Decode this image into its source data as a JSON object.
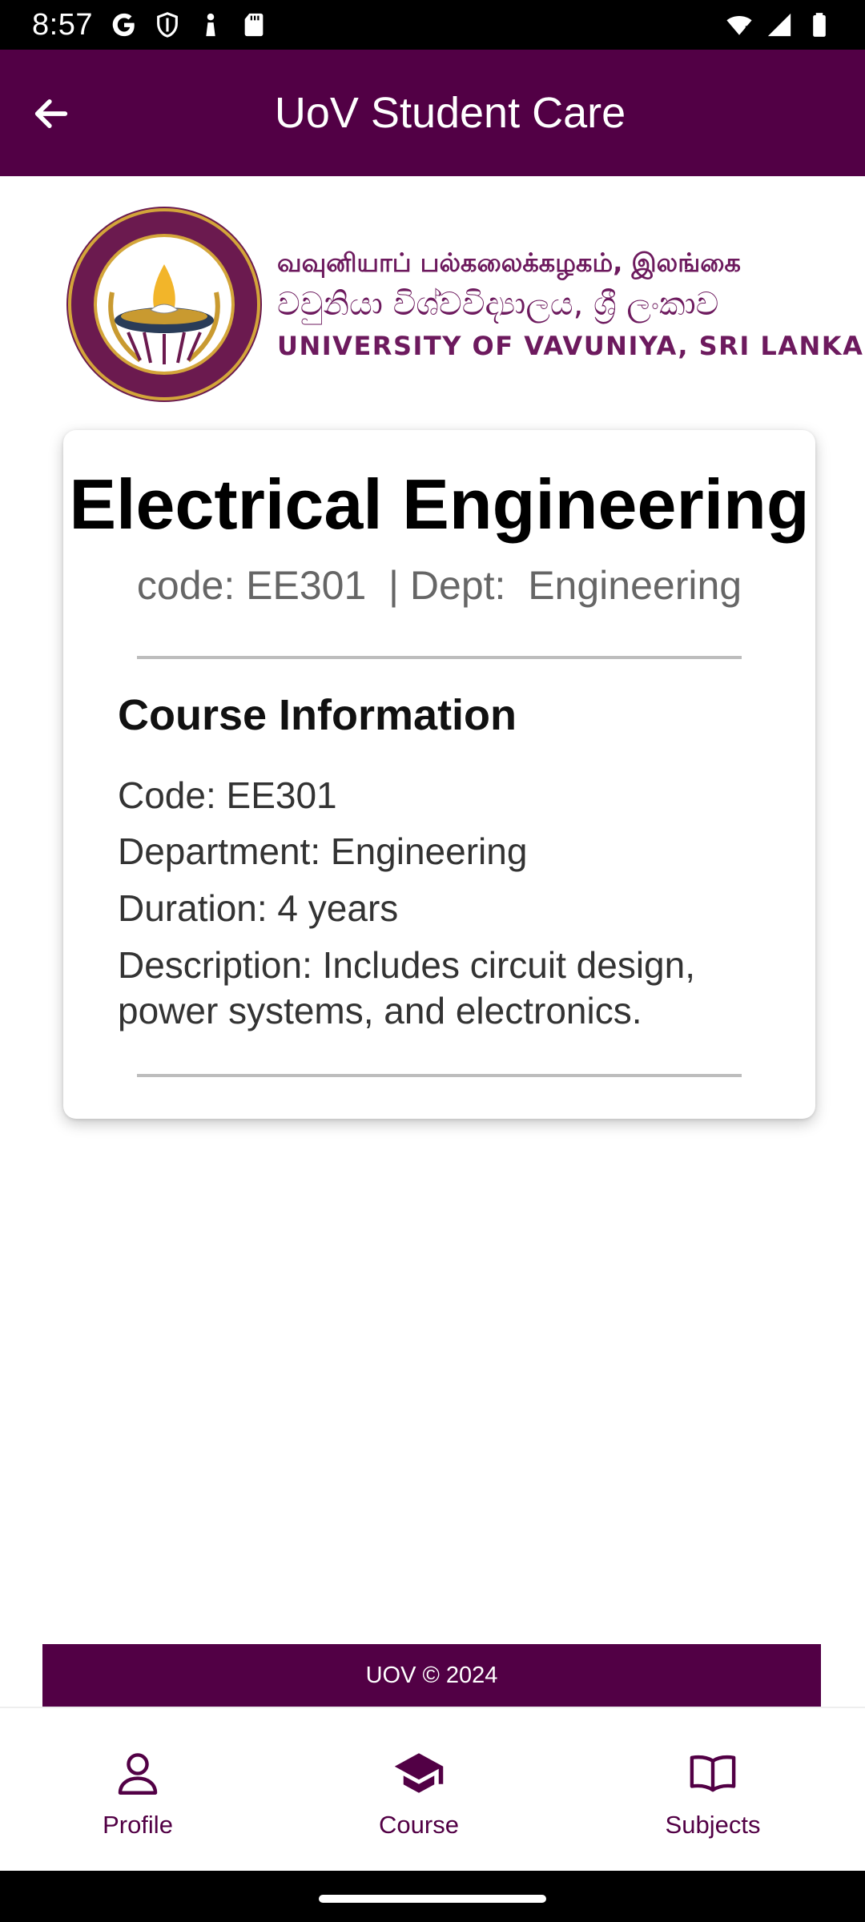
{
  "status_bar": {
    "time": "8:57",
    "left_icons": [
      "google-icon",
      "shield-icon",
      "person-icon",
      "sd-card-icon"
    ],
    "right_icons": [
      "wifi-icon",
      "signal-icon",
      "battery-icon"
    ]
  },
  "app_bar": {
    "title": "UoV Student Care",
    "back_icon": "arrow-left-icon",
    "color": "#520045"
  },
  "banner": {
    "line_tamil": "வவுனியாப் பல்கலைக்கழகம், இலங்கை",
    "line_sinhala": "වවුනියා විශ්වවිද්‍යාලය, ශ්‍රී ලංකාව",
    "line_english": "UNIVERSITY OF VAVUNIYA, SRI LANKA",
    "text_color": "#6d1a5e"
  },
  "course": {
    "title": "Electrical Engineering",
    "subtitle": "code: EE301  | Dept:  Engineering",
    "info_heading": "Course Information",
    "code_line": "Code: EE301",
    "department_line": "Department: Engineering",
    "duration_line": "Duration: 4 years",
    "description_line": "Description: Includes circuit design, power systems, and electronics."
  },
  "footer": {
    "text": "UOV © 2024"
  },
  "bottom_nav": {
    "items": [
      {
        "label": "Profile",
        "icon": "person-outline-icon",
        "active": false
      },
      {
        "label": "Course",
        "icon": "graduation-cap-icon",
        "active": true
      },
      {
        "label": "Subjects",
        "icon": "open-book-icon",
        "active": false
      }
    ]
  }
}
